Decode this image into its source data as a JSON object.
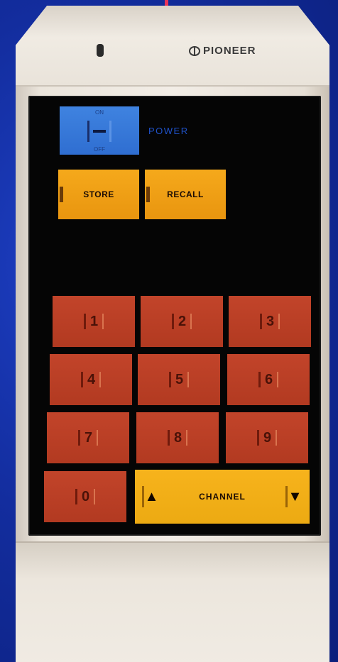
{
  "brand": "PIONEER",
  "power": {
    "on_label": "ON",
    "off_label": "OFF",
    "label": "POWER"
  },
  "memory": {
    "store_label": "STORE",
    "recall_label": "RECALL"
  },
  "keypad": [
    "1",
    "2",
    "3",
    "4",
    "5",
    "6",
    "7",
    "8",
    "9"
  ],
  "zero_label": "0",
  "channel": {
    "label": "CHANNEL",
    "up_symbol": "▲",
    "down_symbol": "▼"
  },
  "colors": {
    "background": "#132d9e",
    "power_button": "#3378d8",
    "memory_button": "#f0a015",
    "number_button": "#b93e25",
    "channel_button": "#f2ae16",
    "panel": "#050505",
    "body": "#eee8df"
  }
}
